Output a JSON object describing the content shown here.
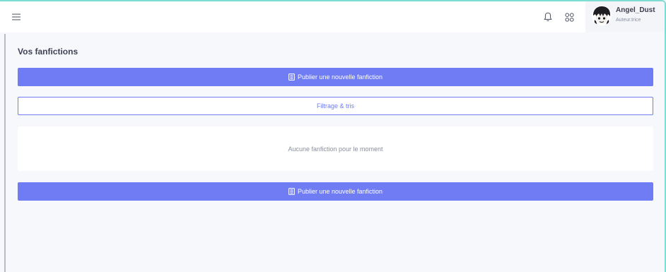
{
  "topbar": {
    "menu_icon": "hamburger-menu-icon",
    "notification_icon": "bell-icon",
    "apps_icon": "apps-grid-icon"
  },
  "user": {
    "name": "Angel_Dust",
    "role": "Auteur.trice"
  },
  "main": {
    "title": "Vos fanfictions",
    "publish_label": "Publier une nouvelle fanfiction",
    "filter_label": "Filtrage & tris",
    "empty_message": "Aucune fanfiction pour le moment",
    "publish_label_bottom": "Publier une nouvelle fanfiction"
  },
  "colors": {
    "accent": "#6f7cf3",
    "frame_border": "#7fdcd2",
    "page_background": "#f7f8fc"
  }
}
